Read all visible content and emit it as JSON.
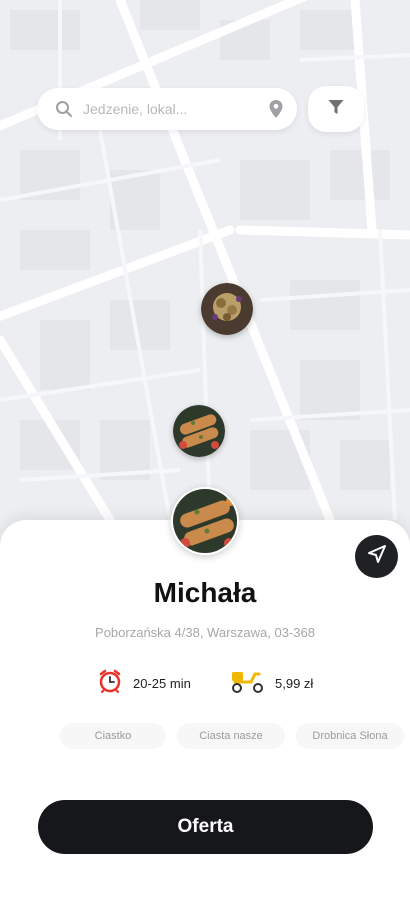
{
  "search": {
    "placeholder": "Jedzenie, lokal..."
  },
  "icons": {
    "search": "search-icon",
    "location": "location-pin-icon",
    "filter": "filter-icon",
    "navigate": "navigation-arrow-icon",
    "time": "alarm-clock-icon",
    "delivery": "delivery-scooter-icon"
  },
  "place": {
    "name": "Michała",
    "address": "Poborzańska 4/38, Warszawa, 03-368",
    "delivery_time": "20-25 min",
    "delivery_fee": "5,99 zł",
    "tags": [
      "Ciastko",
      "Ciasta nasze",
      "Drobnica Słona"
    ]
  },
  "cta_label": "Oferta",
  "colors": {
    "dark": "#16171a",
    "map_bg": "#eceef1",
    "muted_text": "#a7a7ab"
  }
}
